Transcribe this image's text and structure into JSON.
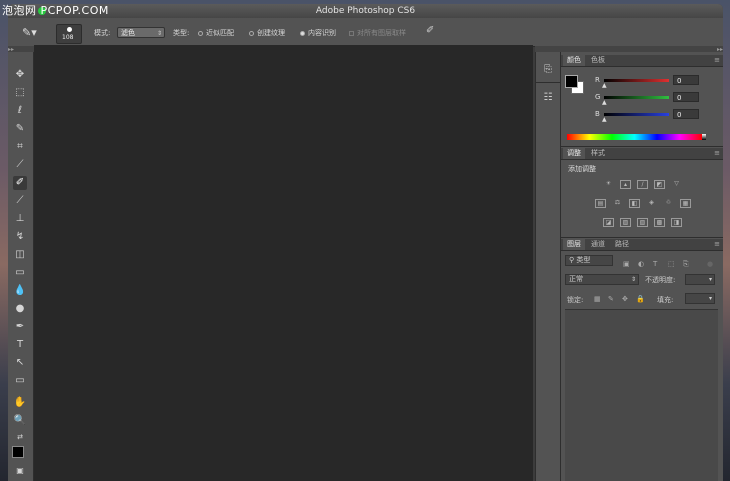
{
  "watermark": "泡泡网 PCPOP.COM",
  "window": {
    "title": "Adobe Photoshop CS6"
  },
  "options_bar": {
    "brush_size": "108",
    "mode_label": "模式:",
    "mode_value": "滤色",
    "type_label": "类型:",
    "opt_proximity": "近似匹配",
    "opt_texture": "创建纹理",
    "opt_content_aware": "内容识别",
    "sample_all_layers": "对所有图层取样",
    "selected_type": "内容识别"
  },
  "tools": [
    "move-tool",
    "marquee-tool",
    "lasso-tool",
    "quick-select-tool",
    "crop-tool",
    "eyedropper-tool",
    "spot-healing-brush-tool",
    "brush-tool",
    "clone-stamp-tool",
    "history-brush-tool",
    "eraser-tool",
    "gradient-tool",
    "blur-tool",
    "dodge-tool",
    "pen-tool",
    "type-tool",
    "path-select-tool",
    "shape-tool",
    "hand-tool",
    "zoom-tool"
  ],
  "color_panel": {
    "tab_color": "颜色",
    "tab_swatches": "色板",
    "r_label": "R",
    "r_value": "0",
    "g_label": "G",
    "g_value": "0",
    "b_label": "B",
    "b_value": "0"
  },
  "adjust_panel": {
    "tab_adjust": "调整",
    "tab_styles": "样式",
    "add_adjust": "添加调整"
  },
  "layers_panel": {
    "tab_layers": "图层",
    "tab_channels": "通道",
    "tab_paths": "路径",
    "filter_kind": "类型",
    "blend_mode": "正常",
    "opacity_label": "不透明度:",
    "lock_label": "锁定:",
    "fill_label": "填充:"
  },
  "colors": {
    "red_track": "#c0392b",
    "green_track": "#27ae60",
    "blue_track": "#2440d8"
  }
}
